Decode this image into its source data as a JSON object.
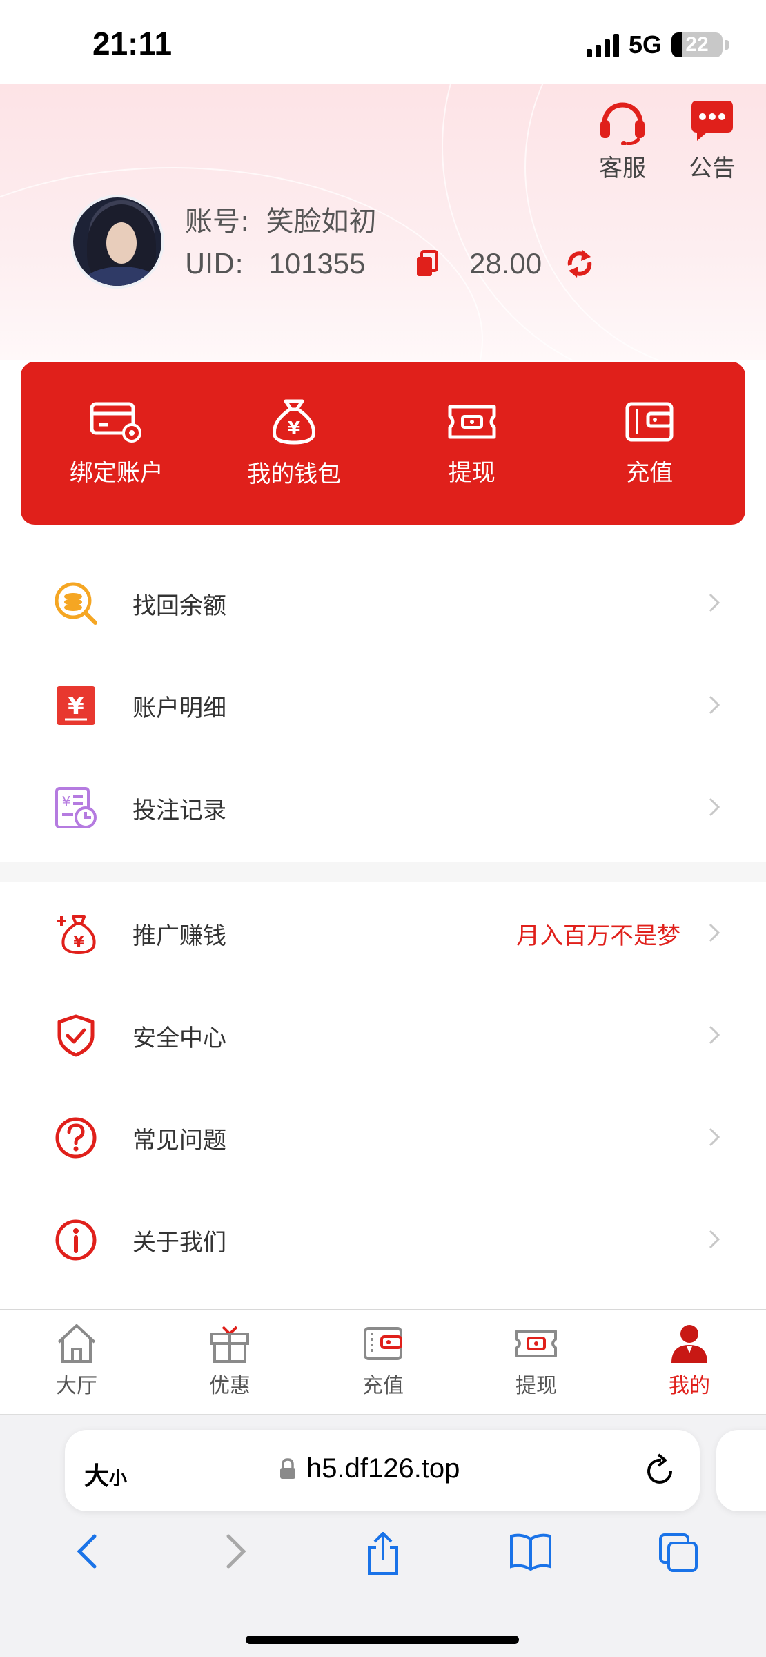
{
  "status_bar": {
    "time": "21:11",
    "network": "5G",
    "battery": "22"
  },
  "header": {
    "top_icons": [
      {
        "label": "客服",
        "icon": "headset-icon"
      },
      {
        "label": "公告",
        "icon": "message-icon"
      }
    ],
    "account_label": "账号:",
    "account_value": "笑脸如初",
    "uid_label": "UID:",
    "uid_value": "101355",
    "balance": "28.00"
  },
  "quick_actions": [
    {
      "label": "绑定账户",
      "icon": "card-settings-icon"
    },
    {
      "label": "我的钱包",
      "icon": "money-bag-icon"
    },
    {
      "label": "提现",
      "icon": "withdraw-ticket-icon"
    },
    {
      "label": "充值",
      "icon": "wallet-icon"
    }
  ],
  "menu_group_1": [
    {
      "label": "找回余额",
      "icon": "coin-search-icon"
    },
    {
      "label": "账户明细",
      "icon": "yuan-ledger-icon"
    },
    {
      "label": "投注记录",
      "icon": "bet-history-icon"
    }
  ],
  "menu_group_2": [
    {
      "label": "推广赚钱",
      "icon": "promo-money-bag-icon",
      "extra": "月入百万不是梦"
    },
    {
      "label": "安全中心",
      "icon": "shield-check-icon"
    },
    {
      "label": "常见问题",
      "icon": "question-icon"
    },
    {
      "label": "关于我们",
      "icon": "info-icon"
    }
  ],
  "tabbar": [
    {
      "label": "大厅",
      "icon": "home-icon",
      "active": false
    },
    {
      "label": "优惠",
      "icon": "gift-icon",
      "active": false
    },
    {
      "label": "充值",
      "icon": "wallet-icon",
      "active": false
    },
    {
      "label": "提现",
      "icon": "withdraw-ticket-icon",
      "active": false
    },
    {
      "label": "我的",
      "icon": "person-icon",
      "active": true
    }
  ],
  "browser": {
    "text_size_big": "大",
    "text_size_small": "小",
    "url": "h5.df126.top"
  },
  "colors": {
    "accent": "#e0201b",
    "header_bg": "#fde3e6"
  }
}
